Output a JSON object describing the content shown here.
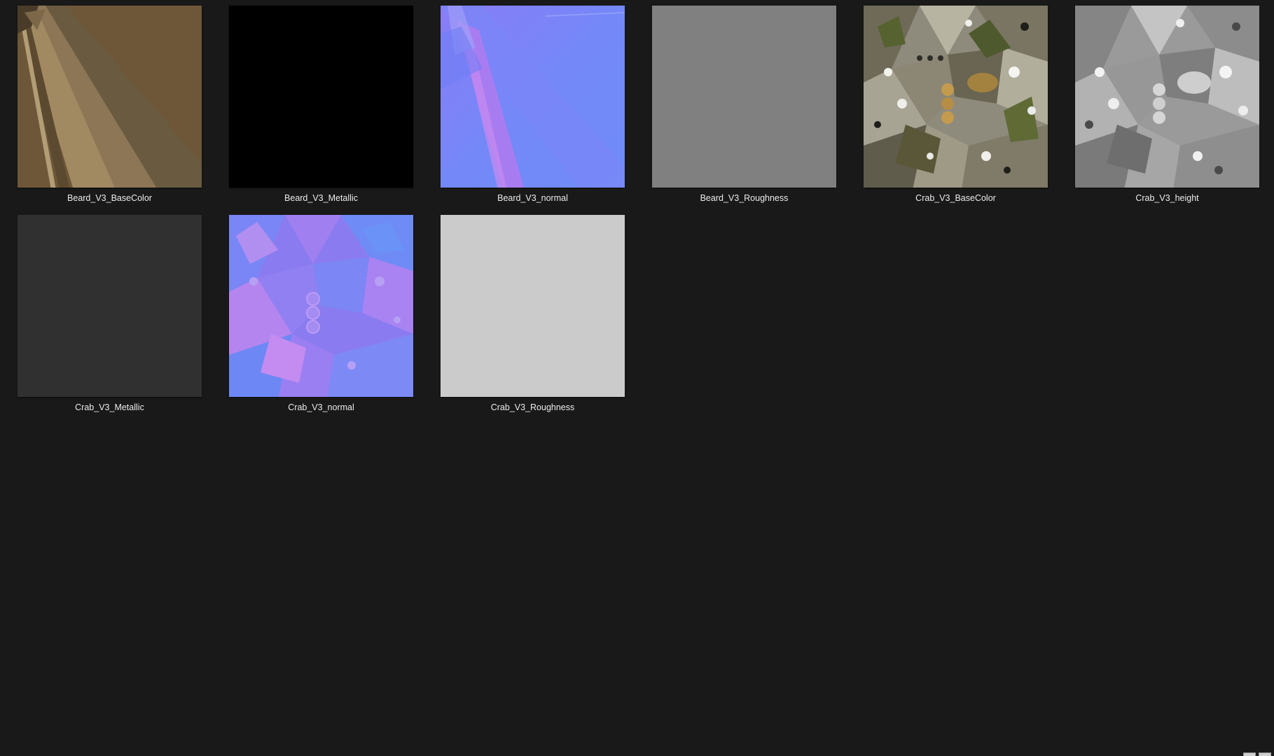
{
  "files": [
    {
      "name": "Beard_V3_BaseColor",
      "icon": "image-thumbnail"
    },
    {
      "name": "Beard_V3_Metallic",
      "icon": "image-thumbnail"
    },
    {
      "name": "Beard_V3_normal",
      "icon": "image-thumbnail"
    },
    {
      "name": "Beard_V3_Roughness",
      "icon": "image-thumbnail"
    },
    {
      "name": "Crab_V3_BaseColor",
      "icon": "image-thumbnail"
    },
    {
      "name": "Crab_V3_height",
      "icon": "image-thumbnail"
    },
    {
      "name": "Crab_V3_Metallic",
      "icon": "image-thumbnail"
    },
    {
      "name": "Crab_V3_normal",
      "icon": "image-thumbnail"
    },
    {
      "name": "Crab_V3_Roughness",
      "icon": "image-thumbnail"
    }
  ],
  "colors": {
    "background": "#191919",
    "label": "#ececec",
    "beard_basecolor": "#6e5738",
    "beard_metallic": "#000000",
    "beard_normal": "#7a84f7",
    "beard_roughness": "#808080",
    "crab_metallic": "#303030",
    "crab_normal": "#8a7cf0",
    "crab_roughness": "#cbcbcb"
  },
  "view_toggle": {
    "icons": [
      "details-view-icon",
      "large-icons-view-icon"
    ]
  }
}
